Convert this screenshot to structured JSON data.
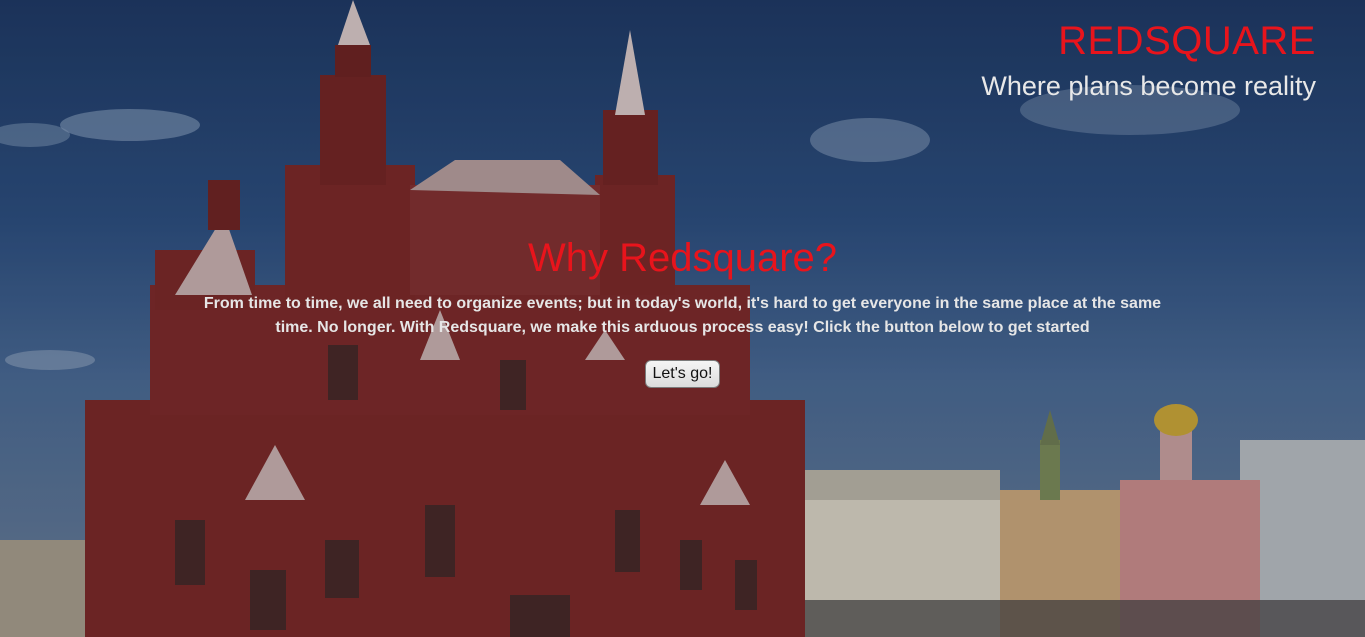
{
  "header": {
    "brand": "REDSQUARE",
    "tagline": "Where plans become reality"
  },
  "hero": {
    "title": "Why Redsquare?",
    "description": "From time to time, we all need to organize events; but in today's world, it's hard to get everyone in the same place at the same time. No longer. With Redsquare, we make this arduous process easy! Click the button below to get started",
    "button_label": "Let's go!"
  },
  "colors": {
    "brand": "#e8141c",
    "title": "#e8141c",
    "text": "#e6e6e6",
    "tagline": "#e8e8e8"
  },
  "icons": {
    "background": "red-square-museum-photo"
  }
}
